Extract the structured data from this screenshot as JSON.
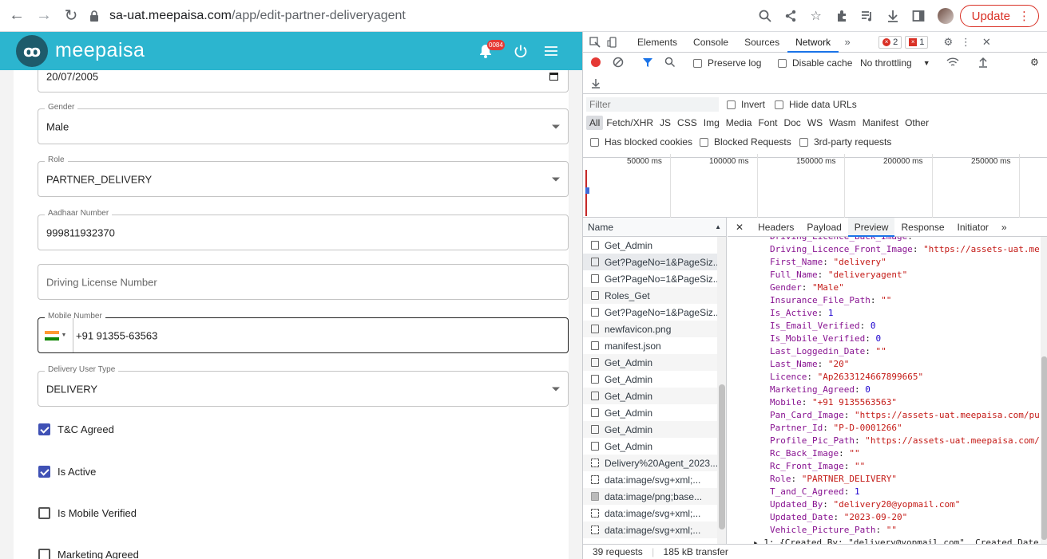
{
  "browser": {
    "url_host": "sa-uat.meepaisa.com",
    "url_path": "/app/edit-partner-deliveryagent",
    "update_label": "Update"
  },
  "app": {
    "logo_text": "meepaisa",
    "logo_mark": "ꝏ",
    "notification_count": "0084"
  },
  "form": {
    "dob": {
      "value": "20/07/2005"
    },
    "gender": {
      "label": "Gender",
      "value": "Male"
    },
    "role": {
      "label": "Role",
      "value": "PARTNER_DELIVERY"
    },
    "aadhaar": {
      "label": "Aadhaar Number",
      "value": "999811932370"
    },
    "driving_license": {
      "placeholder": "Driving License Number"
    },
    "mobile": {
      "label": "Mobile Number",
      "value": "+91 91355-63563"
    },
    "delivery_type": {
      "label": "Delivery User Type",
      "value": "DELIVERY"
    },
    "checkboxes": [
      {
        "label": "T&C Agreed",
        "checked": true
      },
      {
        "label": "Is Active",
        "checked": true
      },
      {
        "label": "Is Mobile Verified",
        "checked": false
      },
      {
        "label": "Marketing Agreed",
        "checked": false
      }
    ]
  },
  "devtools": {
    "tabs": [
      "Elements",
      "Console",
      "Sources",
      "Network"
    ],
    "active_tab": "Network",
    "errors": "2",
    "issues": "1",
    "toolbar": {
      "preserve_log": "Preserve log",
      "disable_cache": "Disable cache",
      "throttling": "No throttling"
    },
    "filter": {
      "placeholder": "Filter",
      "invert": "Invert",
      "hide_data_urls": "Hide data URLs",
      "types": [
        "All",
        "Fetch/XHR",
        "JS",
        "CSS",
        "Img",
        "Media",
        "Font",
        "Doc",
        "WS",
        "Wasm",
        "Manifest",
        "Other"
      ],
      "blocked_cookies": "Has blocked cookies",
      "blocked_requests": "Blocked Requests",
      "third_party": "3rd-party requests"
    },
    "timeline_labels": [
      "50000 ms",
      "100000 ms",
      "150000 ms",
      "200000 ms",
      "250000 ms"
    ],
    "name_header": "Name",
    "requests": [
      {
        "name": "Get_Admin",
        "kind": "doc"
      },
      {
        "name": "Get?PageNo=1&PageSiz...",
        "kind": "doc"
      },
      {
        "name": "Get?PageNo=1&PageSiz...",
        "kind": "doc"
      },
      {
        "name": "Roles_Get",
        "kind": "doc"
      },
      {
        "name": "Get?PageNo=1&PageSiz...",
        "kind": "doc"
      },
      {
        "name": "newfavicon.png",
        "kind": "doc"
      },
      {
        "name": "manifest.json",
        "kind": "doc"
      },
      {
        "name": "Get_Admin",
        "kind": "doc"
      },
      {
        "name": "Get_Admin",
        "kind": "doc"
      },
      {
        "name": "Get_Admin",
        "kind": "doc"
      },
      {
        "name": "Get_Admin",
        "kind": "doc"
      },
      {
        "name": "Get_Admin",
        "kind": "doc"
      },
      {
        "name": "Get_Admin",
        "kind": "doc"
      },
      {
        "name": "Delivery%20Agent_2023...",
        "kind": "svg"
      },
      {
        "name": "data:image/svg+xml;...",
        "kind": "svg"
      },
      {
        "name": "data:image/png;base...",
        "kind": "img"
      },
      {
        "name": "data:image/svg+xml;...",
        "kind": "svg"
      },
      {
        "name": "data:image/svg+xml;...",
        "kind": "svg"
      }
    ],
    "detail_tabs": [
      "Headers",
      "Payload",
      "Preview",
      "Response",
      "Initiator"
    ],
    "active_detail_tab": "Preview",
    "preview_lines": [
      {
        "k": "Driving_Licence_Back_Image",
        "v": "\"\"",
        "t": "s"
      },
      {
        "k": "Driving_Licence_Front_Image",
        "v": "\"https://assets-uat.me",
        "t": "s"
      },
      {
        "k": "First_Name",
        "v": "\"delivery\"",
        "t": "s"
      },
      {
        "k": "Full_Name",
        "v": "\"deliveryagent\"",
        "t": "s"
      },
      {
        "k": "Gender",
        "v": "\"Male\"",
        "t": "s"
      },
      {
        "k": "Insurance_File_Path",
        "v": "\"\"",
        "t": "s"
      },
      {
        "k": "Is_Active",
        "v": "1",
        "t": "n"
      },
      {
        "k": "Is_Email_Verified",
        "v": "0",
        "t": "n"
      },
      {
        "k": "Is_Mobile_Verified",
        "v": "0",
        "t": "n"
      },
      {
        "k": "Last_Loggedin_Date",
        "v": "\"\"",
        "t": "s"
      },
      {
        "k": "Last_Name",
        "v": "\"20\"",
        "t": "s"
      },
      {
        "k": "Licence",
        "v": "\"Ap2633124667899665\"",
        "t": "s"
      },
      {
        "k": "Marketing_Agreed",
        "v": "0",
        "t": "n"
      },
      {
        "k": "Mobile",
        "v": "\"+91 9135563563\"",
        "t": "s"
      },
      {
        "k": "Pan_Card_Image",
        "v": "\"https://assets-uat.meepaisa.com/pu",
        "t": "s"
      },
      {
        "k": "Partner_Id",
        "v": "\"P-D-0001266\"",
        "t": "s"
      },
      {
        "k": "Profile_Pic_Path",
        "v": "\"https://assets-uat.meepaisa.com/",
        "t": "s"
      },
      {
        "k": "Rc_Back_Image",
        "v": "\"\"",
        "t": "s"
      },
      {
        "k": "Rc_Front_Image",
        "v": "\"\"",
        "t": "s"
      },
      {
        "k": "Role",
        "v": "\"PARTNER_DELIVERY\"",
        "t": "s"
      },
      {
        "k": "T_and_C_Agreed",
        "v": "1",
        "t": "n"
      },
      {
        "k": "Updated_By",
        "v": "\"delivery20@yopmail.com\"",
        "t": "s"
      },
      {
        "k": "Updated_Date",
        "v": "\"2023-09-20\"",
        "t": "s"
      },
      {
        "k": "Vehicle_Picture_Path",
        "v": "\"\"",
        "t": "s"
      }
    ],
    "collapsed_entry": "▸ 1: {Created_By: \"delivery@yopmail.com\", Created_Date",
    "status": {
      "requests": "39 requests",
      "transferred": "185 kB transfer"
    }
  }
}
